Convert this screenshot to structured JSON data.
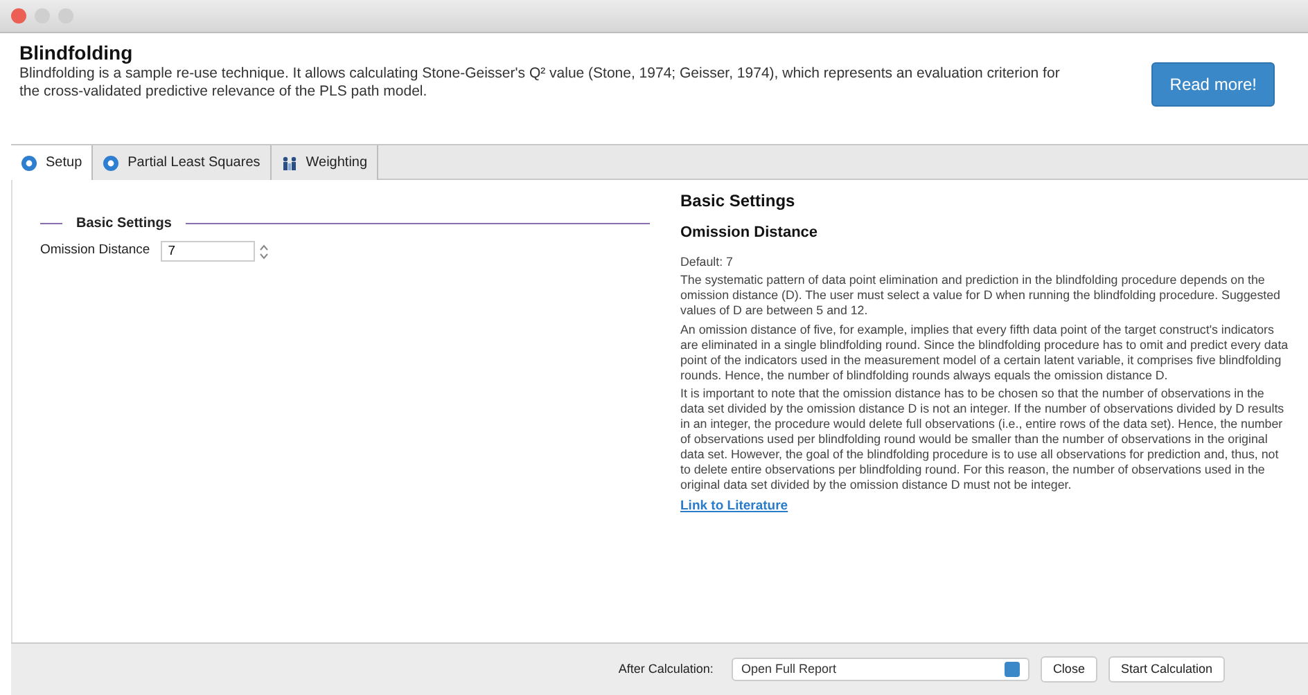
{
  "window": {
    "controls": [
      {
        "color": "#ec5f55"
      },
      {
        "color": "#cfcfcf"
      },
      {
        "color": "#cfcfcf"
      }
    ]
  },
  "header": {
    "title": "Blindfolding",
    "description": "Blindfolding is a sample re-use technique. It allows calculating Stone-Geisser's Q² value (Stone, 1974; Geisser, 1974), which represents an evaluation criterion for the cross-validated predictive relevance of the PLS path model.",
    "button": "Read more!"
  },
  "tabs": [
    {
      "label": "Setup",
      "kind": "gear",
      "selected": true
    },
    {
      "label": "Partial Least Squares",
      "kind": "gear",
      "selected": false
    },
    {
      "label": "Weighting",
      "kind": "people",
      "selected": false
    }
  ],
  "settings": {
    "group": "Basic Settings",
    "fields": [
      {
        "label": "Omission Distance",
        "value": "7"
      }
    ]
  },
  "help": {
    "heading": "Basic Settings",
    "subheading": "Omission Distance",
    "paragraphs": [
      "Default: 7",
      "The systematic pattern of data point elimination and prediction in the blindfolding procedure depends on the omission distance (D). The user must select a value for D when running the blindfolding procedure. Suggested values of D are between 5 and 12.",
      "An omission distance of five, for example, implies that every fifth data point of the target construct's indicators are eliminated in a single blindfolding round. Since the blindfolding procedure has to omit and predict every data point of the indicators used in the measurement model of a certain latent variable, it comprises five blindfolding rounds. Hence, the number of blindfolding rounds always equals the omission distance D.",
      "It is important to note that the omission distance has to be chosen so that the number of observations in the data set divided by the omission distance D is not an integer. If the number of observations divided by D results in an integer, the procedure would delete full observations (i.e., entire rows of the data set). Hence, the number of observations used per blindfolding round would be smaller than the number of observations in the original data set. However, the goal of the blindfolding procedure is to use all observations for prediction and, thus, not to delete entire observations per blindfolding round. For this reason, the number of observations used in the original data set divided by the omission distance D must not be integer."
    ],
    "link": "Link to Literature"
  },
  "footer": {
    "label": "After Calculation:",
    "select": "Open Full Report",
    "buttons": [
      "Close",
      "Start Calculation"
    ]
  }
}
